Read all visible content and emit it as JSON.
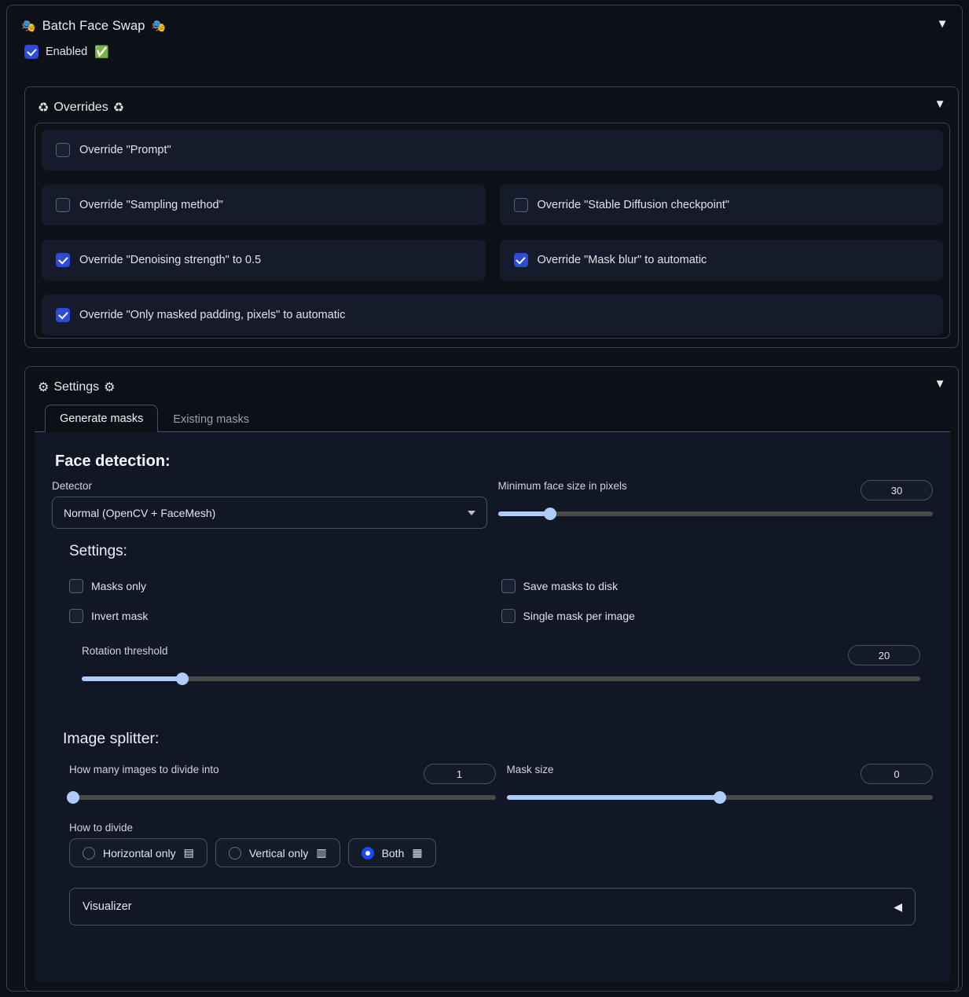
{
  "panel": {
    "title": "Batch Face Swap",
    "title_emoji_left": "🎭",
    "title_emoji_right": "🎭",
    "collapse_arrow": "▼",
    "enabled_label": "Enabled",
    "enabled_emoji": "✅",
    "enabled_checked": true
  },
  "overrides": {
    "title": "Overrides",
    "icon_left": "♻",
    "icon_right": "♻",
    "collapse_arrow": "▼",
    "items": [
      {
        "label": "Override \"Prompt\"",
        "checked": false
      },
      {
        "label": "Override \"Sampling method\"",
        "checked": false
      },
      {
        "label": "Override \"Stable Diffusion checkpoint\"",
        "checked": false
      },
      {
        "label": "Override \"Denoising strength\" to 0.5",
        "checked": true
      },
      {
        "label": "Override \"Mask blur\" to automatic",
        "checked": true
      },
      {
        "label": "Override \"Only masked padding, pixels\" to automatic",
        "checked": true
      }
    ]
  },
  "settings": {
    "title": "Settings",
    "icon_left": "⚙",
    "icon_right": "⚙",
    "collapse_arrow": "▼",
    "tabs": [
      {
        "label": "Generate masks",
        "active": true
      },
      {
        "label": "Existing masks",
        "active": false
      }
    ],
    "face_detection": {
      "heading": "Face detection:",
      "detector_label": "Detector",
      "detector_value": "Normal (OpenCV + FaceMesh)",
      "min_face_size": {
        "label": "Minimum face size in pixels",
        "value": "30",
        "percent": 12
      }
    },
    "settings_block": {
      "heading": "Settings:",
      "checkboxes_left": [
        {
          "label": "Masks only",
          "checked": false
        },
        {
          "label": "Invert mask",
          "checked": false
        }
      ],
      "checkboxes_right": [
        {
          "label": "Save masks to disk",
          "checked": false
        },
        {
          "label": "Single mask per image",
          "checked": false
        }
      ],
      "rotation_threshold": {
        "label": "Rotation threshold",
        "value": "20",
        "percent": 12
      }
    },
    "image_splitter": {
      "heading": "Image splitter:",
      "divide_count": {
        "label": "How many images to divide into",
        "value": "1",
        "percent": 1
      },
      "mask_size": {
        "label": "Mask size",
        "value": "0",
        "percent": 50
      },
      "how_to_divide_label": "How to divide",
      "options": [
        {
          "label": "Horizontal only",
          "glyph": "▤",
          "selected": false
        },
        {
          "label": "Vertical only",
          "glyph": "▥",
          "selected": false
        },
        {
          "label": "Both",
          "glyph": "▦",
          "selected": true
        }
      ],
      "visualizer": {
        "label": "Visualizer",
        "arrow": "◀"
      }
    }
  }
}
